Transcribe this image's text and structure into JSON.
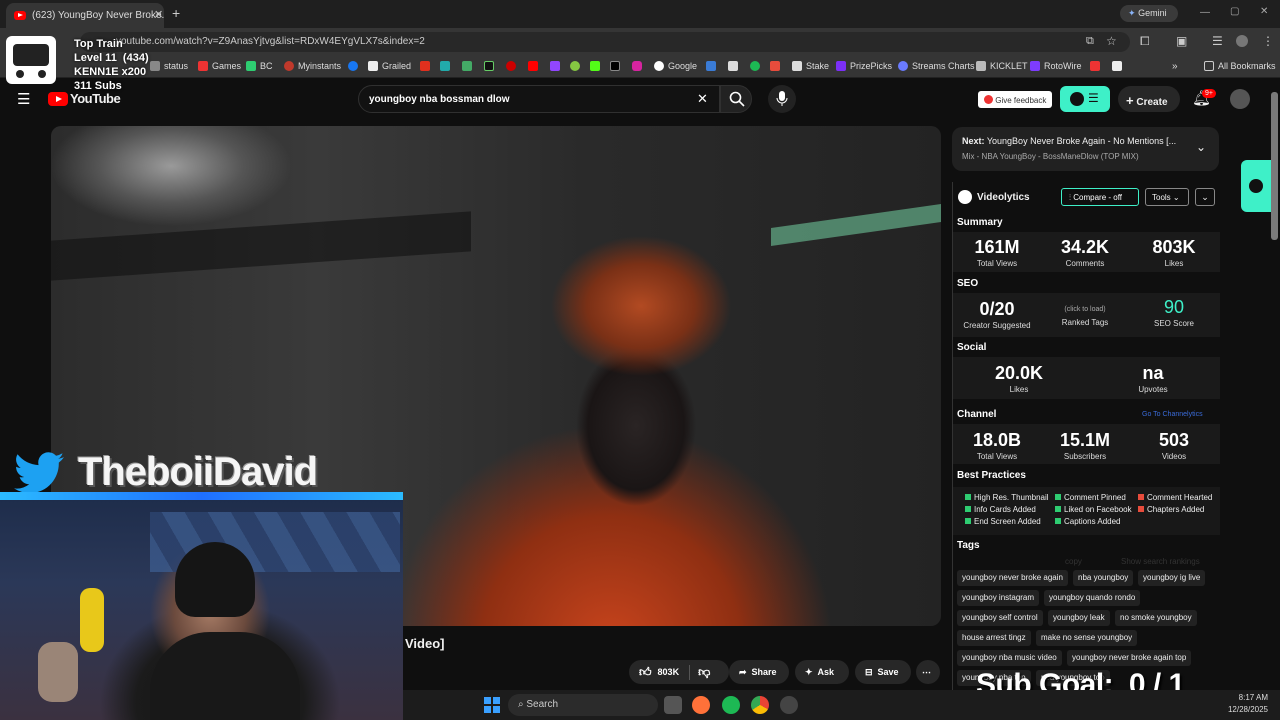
{
  "browser": {
    "tab_title": "(623) YoungBoy Never Broke...",
    "gemini_label": "Gemini",
    "url": "youtube.com/watch?v=Z9AnasYjtvg&list=RDxW4EYgVLX7s&index=2",
    "bookmarks": [
      "status",
      "Games",
      "BC",
      "Myinstants",
      "Grailed",
      "Google",
      "Stake",
      "PrizePicks",
      "Streams Charts",
      "KICKLET",
      "RotoWire"
    ],
    "all_bookmarks": "All Bookmarks"
  },
  "youtube": {
    "logo": "YouTube",
    "search_value": "youngboy nba bossman dlow",
    "feedback_label": "Give feedback",
    "create_label": "Create",
    "notif_badge": "9+"
  },
  "next": {
    "prefix": "Next:",
    "title": "YoungBoy Never Broke Again - No Mentions [...",
    "subtitle": "Mix - NBA YoungBoy - BossManeDlow (TOP MIX)"
  },
  "videolytics": {
    "brand": "Videolytics",
    "compare": "Compare - off",
    "tools": "Tools",
    "summary_label": "Summary",
    "summary": [
      {
        "value": "161M",
        "label": "Total Views"
      },
      {
        "value": "34.2K",
        "label": "Comments"
      },
      {
        "value": "803K",
        "label": "Likes"
      }
    ],
    "seo_label": "SEO",
    "seo": [
      {
        "value": "0/20",
        "label": "Creator Suggested"
      },
      {
        "value": "(click to load)",
        "label": "Ranked Tags"
      },
      {
        "value": "90",
        "label": "SEO Score"
      }
    ],
    "social_label": "Social",
    "social": [
      {
        "value": "20.0K",
        "label": "Likes"
      },
      {
        "value": "na",
        "label": "Upvotes"
      }
    ],
    "channel_label": "Channel",
    "channel_link": "Go To Channelytics",
    "channel": [
      {
        "value": "18.0B",
        "label": "Total Views"
      },
      {
        "value": "15.1M",
        "label": "Subscribers"
      },
      {
        "value": "503",
        "label": "Videos"
      }
    ],
    "bp_label": "Best Practices",
    "best_practices": [
      {
        "label": "High Res. Thumbnail",
        "color": "#2ecc71"
      },
      {
        "label": "Comment Pinned",
        "color": "#2ecc71"
      },
      {
        "label": "Comment Hearted",
        "color": "#e74c3c"
      },
      {
        "label": "Info Cards Added",
        "color": "#2ecc71"
      },
      {
        "label": "Liked on Facebook",
        "color": "#2ecc71"
      },
      {
        "label": "Chapters Added",
        "color": "#e74c3c"
      },
      {
        "label": "End Screen Added",
        "color": "#2ecc71"
      },
      {
        "label": "Captions Added",
        "color": "#2ecc71"
      }
    ],
    "tags_label": "Tags",
    "tags_copy": "copy",
    "tags_show": "Show search rankings",
    "tags": [
      "youngboy never broke again",
      "nba youngboy",
      "youngboy ig live",
      "youngboy instagram",
      "youngboy quando rondo",
      "youngboy self control",
      "youngboy leak",
      "no smoke youngboy",
      "house arrest tingz",
      "make no sense youngboy",
      "youngboy nba music video",
      "youngboy never broke again top",
      "youngboy nba top",
      "nba youngboy top"
    ]
  },
  "actions": {
    "likes": "803K",
    "share": "Share",
    "ask": "Ask",
    "save": "Save",
    "video_suffix": "Video]"
  },
  "stream": {
    "top_train": "Top Train",
    "level": "Level 11  (434)",
    "kennie": "KENN1E x200",
    "subs": "311 Subs",
    "twitter_name": "TheboiiDavid",
    "sub_goal": "Sub Goal:  0 / 1"
  },
  "taskbar": {
    "search": "Search",
    "time": "8:17 AM",
    "date": "12/28/2025"
  },
  "colors": {
    "accent": "#3ef0c8",
    "youtube_red": "#ff0000",
    "twitter": "#1da1f2"
  }
}
